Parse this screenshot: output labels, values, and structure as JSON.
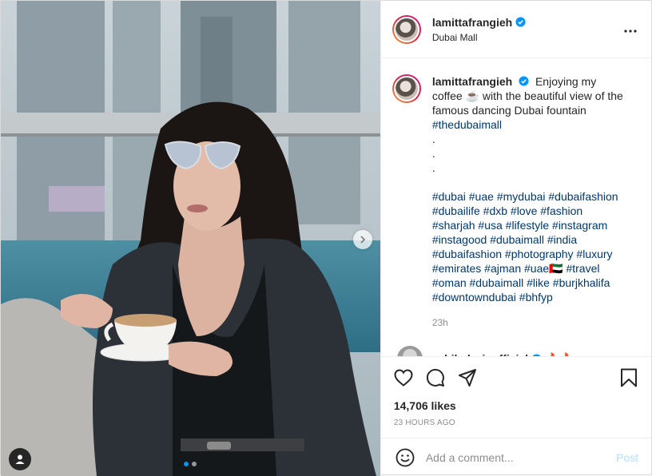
{
  "post": {
    "username": "lamittafrangieh",
    "location": "Dubai Mall",
    "caption_text": "Enjoying my coffee ☕ with the beautiful view of the famous dancing Dubai fountain",
    "caption_tag": "#thedubaimall",
    "caption_dots": [
      ".",
      ".",
      "."
    ],
    "hashtag_lines": [
      "#dubai #uae #mydubai #dubaifashion",
      "#dubailife #dxb #love #fashion",
      "#sharjah #usa #lifestyle #instagram",
      "#instagood #dubaimall #india",
      "#dubaifashion #photography #luxury",
      "#emirates #ajman #uae🇦🇪 #travel",
      "#oman #dubaimall #like #burjkhalifa",
      "#downtowndubai #bhfyp"
    ],
    "caption_time": "23h",
    "next_comment_user": "rabihelzeinofficial",
    "next_comment_text": "🔥🔥",
    "likes": "14,706 likes",
    "posted_ago": "23 HOURS AGO",
    "comment_placeholder": "Add a comment...",
    "post_label": "Post"
  },
  "icons": {
    "more": "more-options-icon",
    "heart": "heart-icon",
    "comment": "comment-icon",
    "share": "share-icon",
    "save": "bookmark-icon",
    "emoji": "emoji-icon",
    "next": "chevron-right-icon",
    "tag": "user-tag-icon",
    "verified": "verified-badge-icon"
  },
  "colors": {
    "verified": "#0095f6",
    "hashtag": "#00376b",
    "muted": "#8e8e8e",
    "post_button_disabled": "#b2dffc"
  },
  "carousel": {
    "total": 2,
    "active": 1
  }
}
